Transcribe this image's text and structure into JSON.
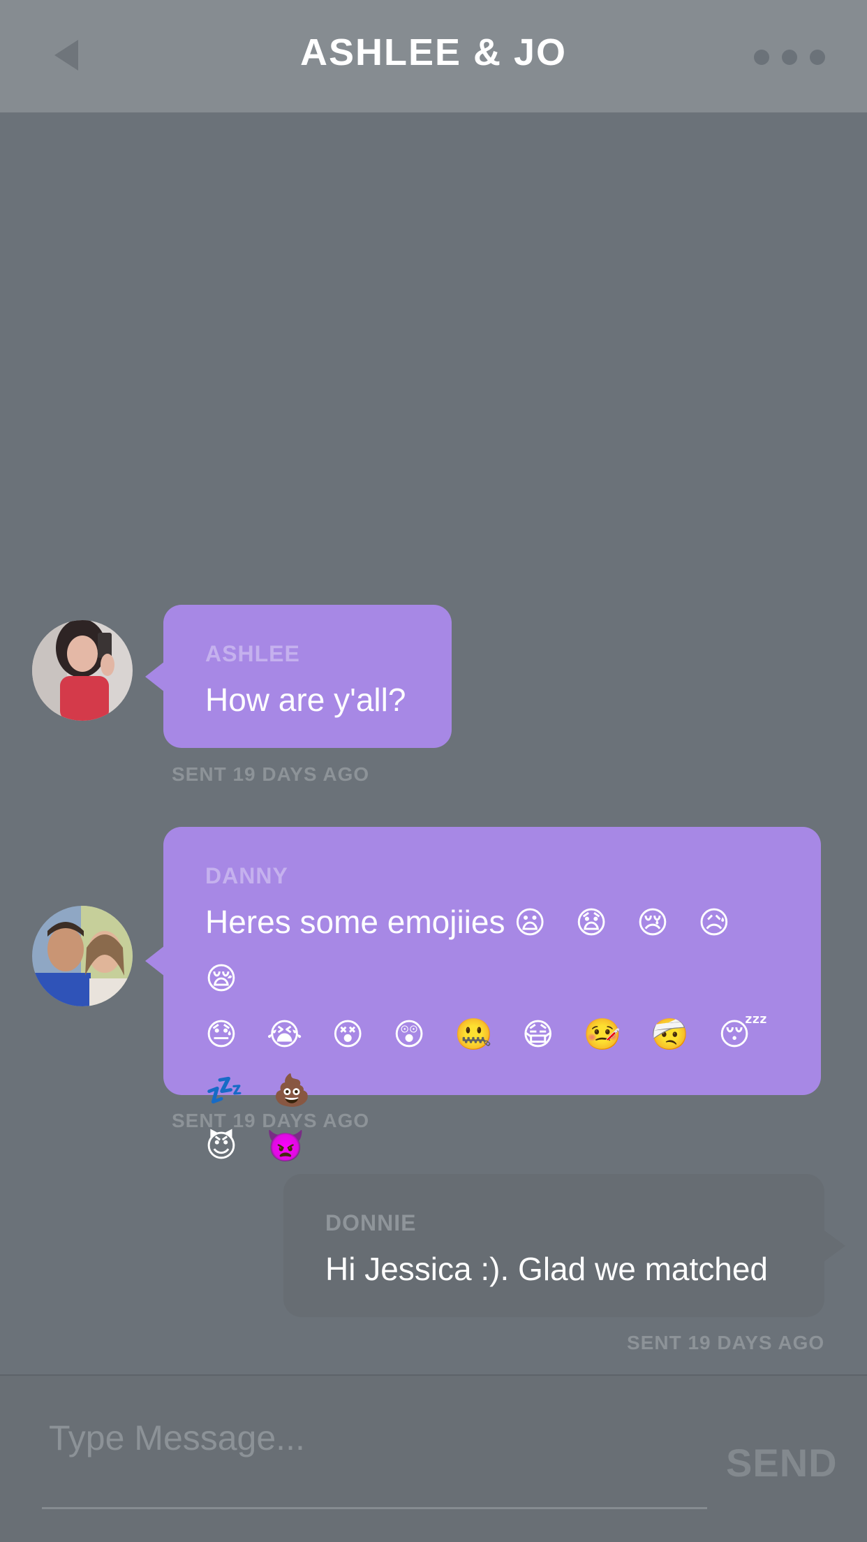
{
  "header": {
    "title": "ASHLEE & JO"
  },
  "messages": [
    {
      "sender": "ASHLEE",
      "text": "How are y'all?",
      "timestamp": "SENT 19 DAYS AGO"
    },
    {
      "sender": "DANNY",
      "text": "Heres some emojiies",
      "emoji_line1": "😦 😧 😢 😥 😪",
      "emoji_line2": "😓 😭 😵 😲 🤐 😷 🤒 🤕 😴 💤 💩",
      "emoji_line3": "😈 👿",
      "timestamp": "SENT 19 DAYS AGO"
    },
    {
      "sender": "DONNIE",
      "text": "Hi Jessica :). Glad we matched",
      "timestamp": "SENT 19 DAYS AGO"
    }
  ],
  "composer": {
    "placeholder": "Type Message...",
    "send_label": "SEND"
  }
}
